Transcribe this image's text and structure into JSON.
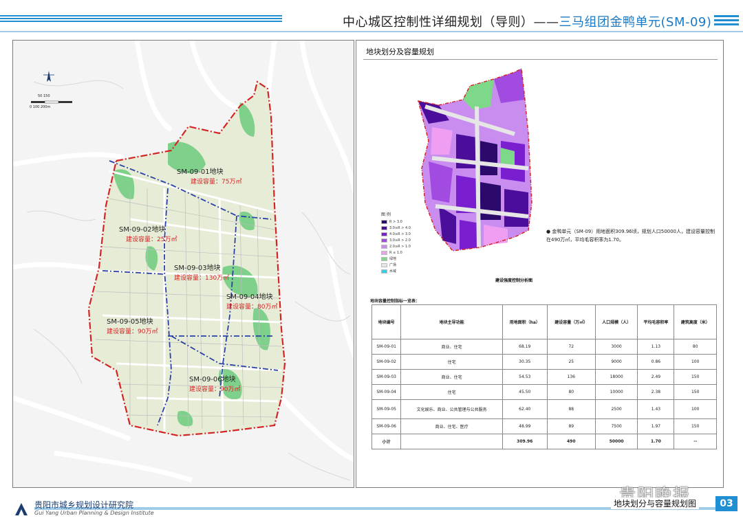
{
  "header": {
    "title_main": "中心城区控制性详细规划（导则）——",
    "title_unit": "三马组团金鸭单元(SM-09)"
  },
  "map": {
    "plots": [
      {
        "name": "SM-09-01地块",
        "capacity": "建设容量：75万㎡"
      },
      {
        "name": "SM-09-02地块",
        "capacity": "建设容量：25万㎡"
      },
      {
        "name": "SM-09-03地块",
        "capacity": "建设容量：130万㎡"
      },
      {
        "name": "SM-09-04地块",
        "capacity": "建设容量：80万㎡"
      },
      {
        "name": "SM-09-05地块",
        "capacity": "建设容量：90万㎡"
      },
      {
        "name": "SM-09-06地块",
        "capacity": "建设容量：90万㎡"
      }
    ],
    "scale": {
      "top": "50   150",
      "bottom": "0    100    200m"
    }
  },
  "right": {
    "section_title": "地块划分及容量规划",
    "legend": {
      "title": "图 例",
      "items": [
        {
          "label": "R > 3.0",
          "color": "#2c0a6b"
        },
        {
          "label": "3.0≥R > 4.0",
          "color": "#4b0e9a"
        },
        {
          "label": "4.0≥R > 3.0",
          "color": "#7a1fcf"
        },
        {
          "label": "3.0≥R > 2.0",
          "color": "#a24be0"
        },
        {
          "label": "2.0≥R > 1.0",
          "color": "#c98cef"
        },
        {
          "label": "R ≤ 1.0",
          "color": "#ef9ef2"
        },
        {
          "label": "绿地",
          "color": "#7ed88a"
        },
        {
          "label": "广场",
          "color": "#e6e6e6"
        },
        {
          "label": "水域",
          "color": "#2ed1e8"
        }
      ]
    },
    "bullet": "● 金鸭单元（SM-09）用地面积309.96顷，规划人口50000人，建设容量控制在490万㎡，平均毛容积率为1.70。",
    "caption": "建设强度控制分析图",
    "table_title": "地块容量控制指标一览表：",
    "table": {
      "headers": [
        "地块编号",
        "地块主导功能",
        "用地面积（ha）",
        "建设容量（万㎡）",
        "人口规模（人）",
        "平均毛容积率",
        "建筑高度（米）"
      ],
      "rows": [
        [
          "SM-09-01",
          "商业、住宅",
          "68.19",
          "72",
          "3000",
          "1.13",
          "80"
        ],
        [
          "SM-09-02",
          "住宅",
          "30.35",
          "25",
          "9000",
          "0.86",
          "100"
        ],
        [
          "SM-09-03",
          "商业、住宅",
          "54.53",
          "136",
          "18000",
          "2.49",
          "150"
        ],
        [
          "SM-09-04",
          "住宅",
          "45.50",
          "80",
          "10000",
          "2.38",
          "150"
        ],
        [
          "SM-09-05",
          "文化娱乐、商业、公共管理与公共服务",
          "62.40",
          "88",
          "2500",
          "1.43",
          "100"
        ],
        [
          "SM-09-06",
          "商业、住宅、医疗",
          "48.99",
          "89",
          "7500",
          "1.97",
          "150"
        ]
      ],
      "total": [
        "小计",
        "",
        "309.96",
        "490",
        "50000",
        "1.70",
        "--"
      ]
    }
  },
  "footer": {
    "org_cn": "贵阳市城乡规划设计研究院",
    "org_en": "Gui Yang Urban Planning & Design Institute",
    "subtitle": "地块划分与容量规划图",
    "page": "03",
    "watermark": "贵阳晚报"
  }
}
